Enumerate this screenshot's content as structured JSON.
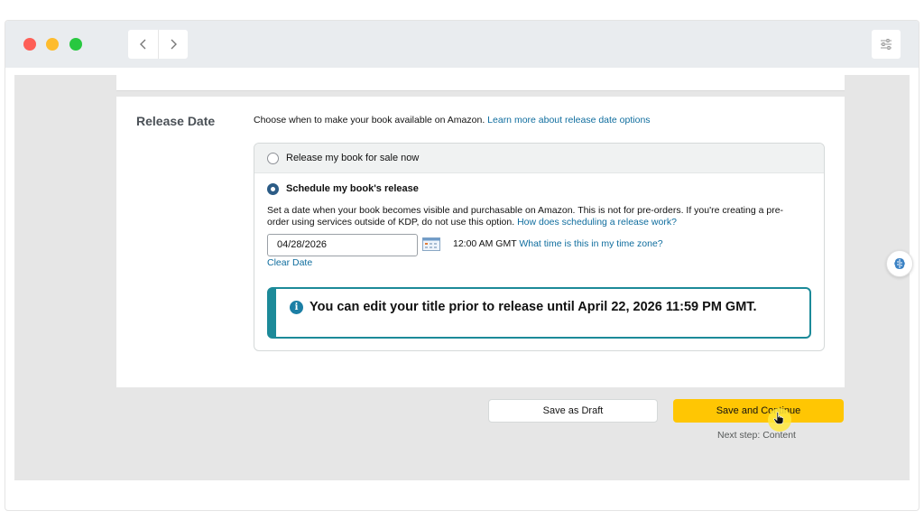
{
  "window": {
    "nav_back_icon": "chevron-left-icon",
    "nav_forward_icon": "chevron-right-icon",
    "settings_icon": "sliders-icon"
  },
  "release": {
    "section_title": "Release Date",
    "intro_text": "Choose when to make your book available on Amazon.",
    "intro_link": "Learn more about release date options",
    "option_now_label": "Release my book for sale now",
    "option_now_checked": false,
    "option_schedule_label": "Schedule my book's release",
    "option_schedule_checked": true,
    "schedule_desc_line1": "Set a date when your book becomes visible and purchasable on Amazon. This is not for pre-orders. If you're creating a pre-",
    "schedule_desc_line2": "order using services outside of KDP, do not use this option.",
    "schedule_desc_link": "How does scheduling a release work?",
    "date_value": "04/28/2026",
    "time_text": "12:00 AM GMT",
    "time_link": "What time is this in my time zone?",
    "clear_date": "Clear Date",
    "alert_text": "You can edit your title prior to release until April 22, 2026 11:59 PM GMT."
  },
  "actions": {
    "save_draft": "Save as Draft",
    "save_continue": "Save and Continue",
    "next_step": "Next step: Content"
  },
  "colors": {
    "accent_button": "#ffc603",
    "link": "#0f6d9e",
    "alert_border": "#1c8a99",
    "radio_checked": "#2c5c86"
  }
}
